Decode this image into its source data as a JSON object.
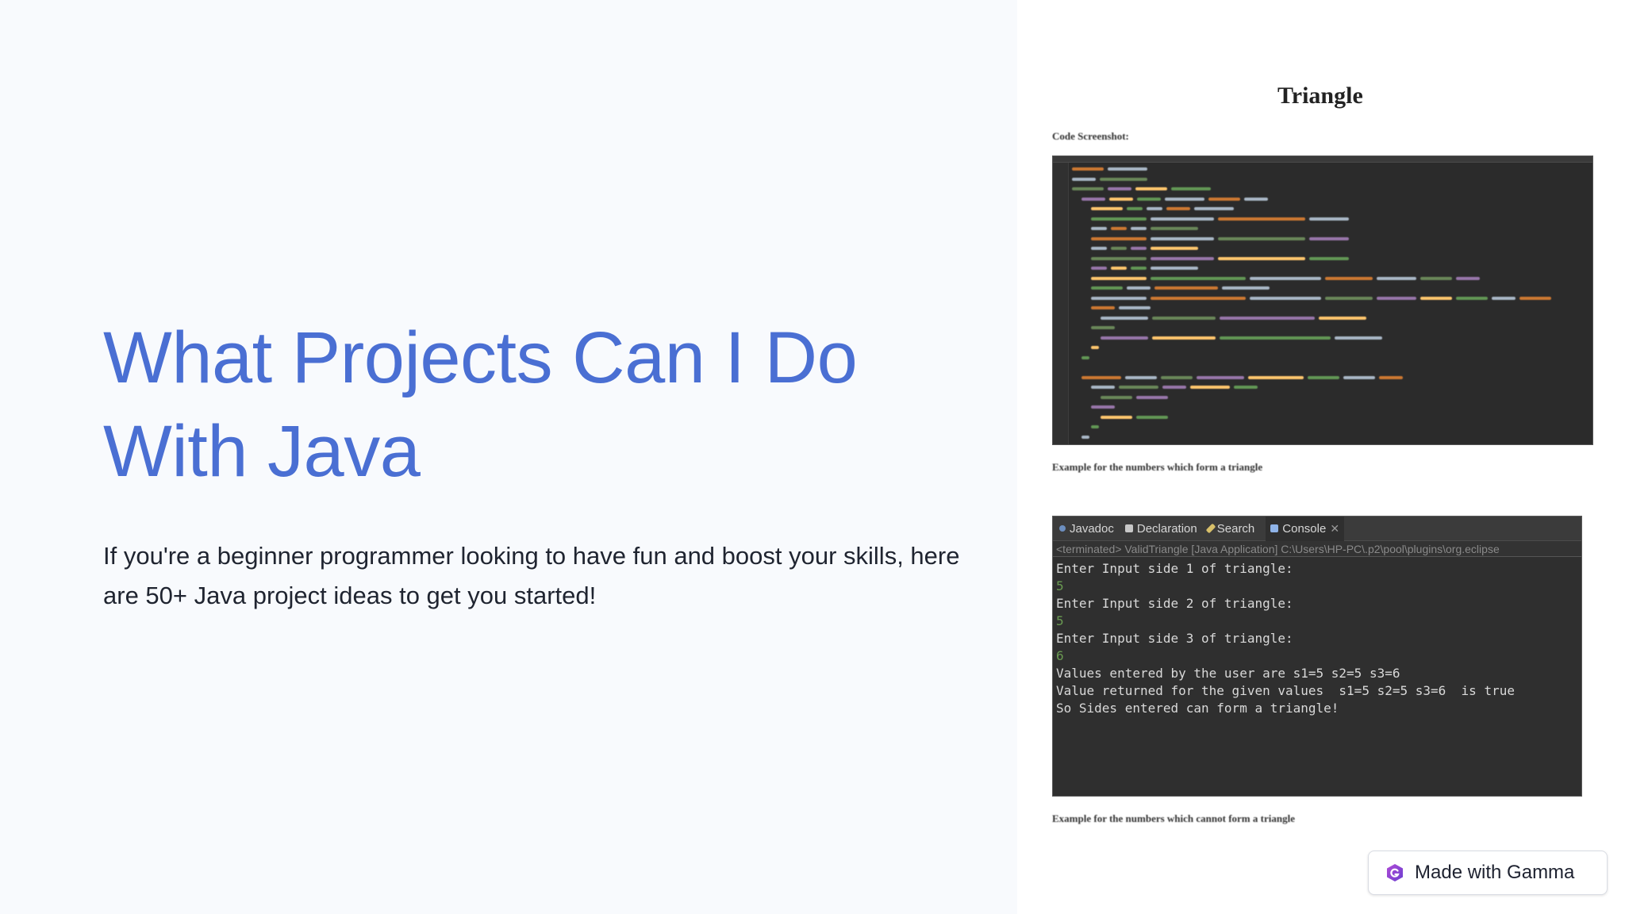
{
  "slide": {
    "title": "What Projects Can I Do With Java",
    "subtitle": "If you're a beginner programmer looking to have fun and boost your skills, here are 50+ Java project ideas to get you started!"
  },
  "doc_image": {
    "title": "Triangle",
    "code_label": "Code Screenshot:",
    "example_true_label": "Example for the numbers which form a triangle",
    "example_false_label": "Example for the numbers which cannot form a triangle"
  },
  "console": {
    "tabs": [
      {
        "label": "Javadoc",
        "icon": "javadoc-icon"
      },
      {
        "label": "Declaration",
        "icon": "declaration-icon"
      },
      {
        "label": "Search",
        "icon": "search-icon"
      },
      {
        "label": "Console",
        "icon": "console-icon"
      }
    ],
    "status": "<terminated> ValidTriangle [Java Application] C:\\Users\\HP-PC\\.p2\\pool\\plugins\\org.eclipse",
    "lines": [
      "Enter Input side 1 of triangle:",
      "5",
      "Enter Input side 2 of triangle:",
      "5",
      "Enter Input side 3 of triangle:",
      "6",
      "Values entered by the user are s1=5 s2=5 s3=6",
      "Value returned for the given values  s1=5 s2=5 s3=6  is true",
      "So Sides entered can form a triangle!"
    ]
  },
  "badge": {
    "label": "Made with Gamma"
  },
  "colors": {
    "title": "#4a6fd3",
    "code_bg": "#2b2b2b",
    "console_input": "#6a9a52"
  }
}
